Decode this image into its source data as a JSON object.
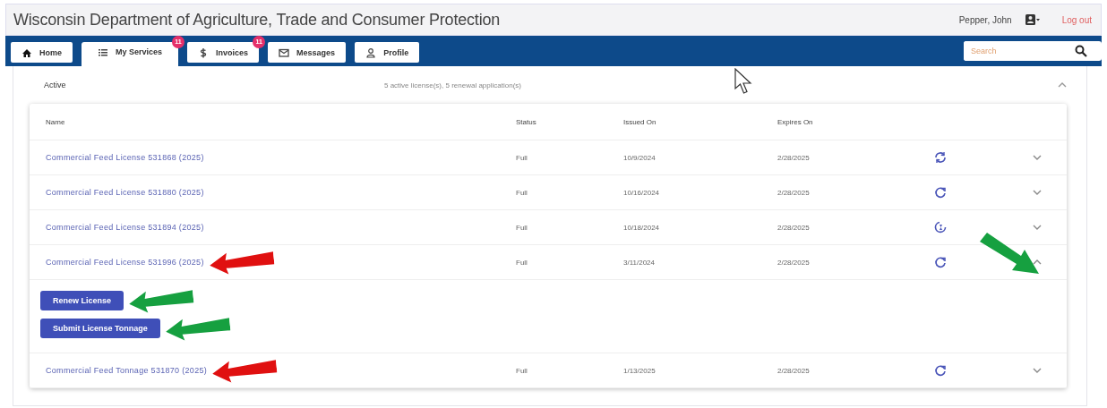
{
  "header": {
    "title": "Wisconsin Department of Agriculture, Trade and Consumer Protection",
    "user": "Pepper, John",
    "logout": "Log out"
  },
  "tabs": [
    {
      "label": "Home",
      "kind": "home",
      "selected": false
    },
    {
      "label": "My Services",
      "kind": "list",
      "selected": true,
      "badge": "11"
    },
    {
      "label": "Invoices",
      "kind": "dollar",
      "selected": false,
      "badge": "11"
    },
    {
      "label": "Messages",
      "kind": "mail",
      "selected": false
    },
    {
      "label": "Profile",
      "kind": "person",
      "selected": false
    }
  ],
  "search": {
    "placeholder": "Search"
  },
  "section": {
    "title": "Active",
    "summary": "5 active license(s), 5 renewal application(s)",
    "expanded": true
  },
  "table": {
    "columns": [
      "Name",
      "Status",
      "Issued On",
      "Expires On"
    ],
    "rows": [
      {
        "name": "Commercial Feed License 531868 (2025)",
        "status": "Full",
        "issued": "10/9/2024",
        "expires": "2/28/2025",
        "kind": "sync",
        "expanded": false
      },
      {
        "name": "Commercial Feed License 531880 (2025)",
        "status": "Full",
        "issued": "10/16/2024",
        "expires": "2/28/2025",
        "kind": "renew",
        "expanded": false
      },
      {
        "name": "Commercial Feed License 531894 (2025)",
        "status": "Full",
        "issued": "10/18/2024",
        "expires": "2/28/2025",
        "kind": "pending",
        "expanded": false
      },
      {
        "name": "Commercial Feed License 531996 (2025)",
        "status": "Full",
        "issued": "3/11/2024",
        "expires": "2/28/2025",
        "kind": "renew",
        "expanded": true,
        "arrow": {
          "color": "#e01010"
        },
        "chevron_arrow": {
          "color": "#16a040"
        },
        "actions": [
          {
            "label": "Renew License",
            "arrow": {
              "color": "#16a040"
            }
          },
          {
            "label": "Submit License Tonnage",
            "arrow": {
              "color": "#16a040"
            }
          }
        ]
      },
      {
        "name": "Commercial Feed Tonnage 531870 (2025)",
        "status": "Full",
        "issued": "1/13/2025",
        "expires": "2/28/2025",
        "kind": "renew",
        "expanded": false,
        "arrow": {
          "color": "#e01010"
        }
      }
    ]
  }
}
